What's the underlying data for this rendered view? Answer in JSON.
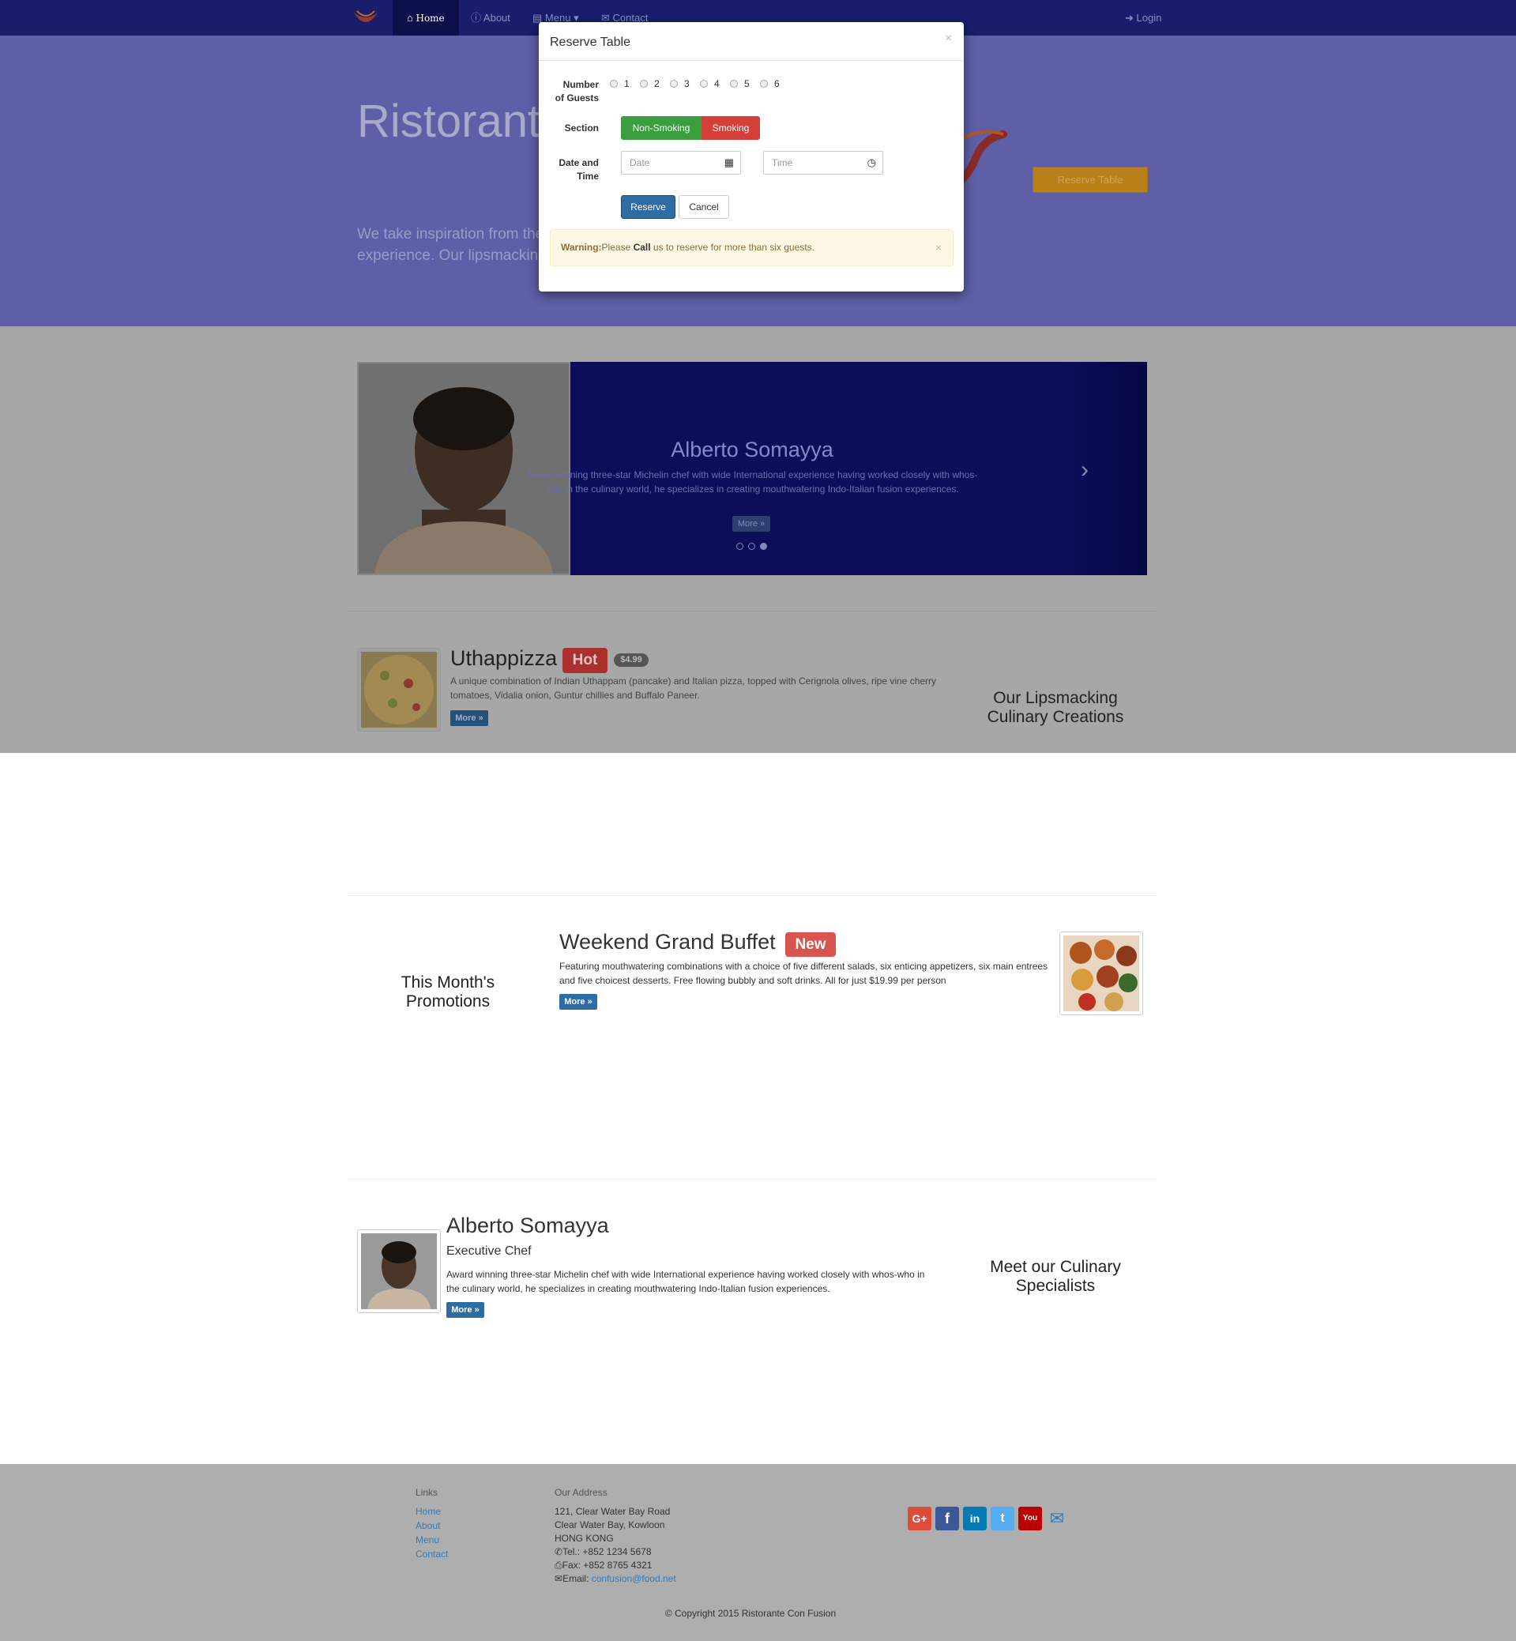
{
  "navbar": {
    "home": "Home",
    "about": "About",
    "menu": "Menu",
    "contact": "Contact",
    "login": "Login"
  },
  "header": {
    "title": "Ristorante",
    "text_line1": "We take inspiration from the",
    "text_line2": "experience. Our lipsmacking",
    "reserve_button": "Reserve Table"
  },
  "modal": {
    "title": "Reserve Table",
    "close": "×",
    "guests_label_1": "Number",
    "guests_label_2": "of Guests",
    "guest_options": [
      "1",
      "2",
      "3",
      "4",
      "5",
      "6"
    ],
    "section_label": "Section",
    "non_smoking": "Non-Smoking",
    "smoking": "Smoking",
    "datetime_label_1": "Date and",
    "datetime_label_2": "Time",
    "date_placeholder": "Date",
    "time_placeholder": "Time",
    "reserve": "Reserve",
    "cancel": "Cancel",
    "warning_strong": "Warning:",
    "warning_pre": "Please ",
    "warning_call": "Call",
    "warning_post": " us to reserve for more than six guests.",
    "warning_close": "×"
  },
  "carousel": {
    "name": "Alberto Somayya",
    "description": "Award winning three-star Michelin chef with wide International experience having worked closely with whos-who in the culinary world, he specializes in creating mouthwatering Indo-Italian fusion experiences.",
    "more": "More »",
    "prev": "‹",
    "next": "›"
  },
  "dish": {
    "title": "Uthappizza",
    "badge": "Hot",
    "price": "$4.99",
    "description": "A unique combination of Indian Uthappam (pancake) and Italian pizza, topped with Cerignola olives, ripe vine cherry tomatoes, Vidalia onion, Guntur chillies and Buffalo Paneer.",
    "more": "More »",
    "side_line1": "Our Lipsmacking",
    "side_line2": "Culinary Creations"
  },
  "promotion": {
    "title": "Weekend Grand Buffet",
    "badge": "New",
    "description": "Featuring mouthwatering combinations with a choice of five different salads, six enticing appetizers, six main entrees and five choicest desserts. Free flowing bubbly and soft drinks. All for just $19.99 per person",
    "more": "More »",
    "side_line1": "This Month's",
    "side_line2": "Promotions"
  },
  "leader": {
    "name": "Alberto Somayya",
    "designation": "Executive Chef",
    "description": "Award winning three-star Michelin chef with wide International experience having worked closely with whos-who in the culinary world, he specializes in creating mouthwatering Indo-Italian fusion experiences.",
    "more": "More »",
    "side_line1": "Meet our Culinary",
    "side_line2": "Specialists"
  },
  "footer": {
    "links_heading": "Links",
    "links": [
      "Home",
      "About",
      "Menu",
      "Contact"
    ],
    "address_heading": "Our Address",
    "address_lines": [
      "121, Clear Water Bay Road",
      "Clear Water Bay, Kowloon",
      "HONG KONG"
    ],
    "tel": "Tel.: +852 1234 5678",
    "fax": "Fax: +852 8765 4321",
    "email_label": "Email: ",
    "email": "confusion@food.net",
    "copyright": "© Copyright 2015 Ristorante Con Fusion",
    "social": {
      "google": "G+",
      "facebook": "f",
      "linkedin": "in",
      "twitter": "t",
      "youtube": "You",
      "mail": "✉"
    }
  }
}
